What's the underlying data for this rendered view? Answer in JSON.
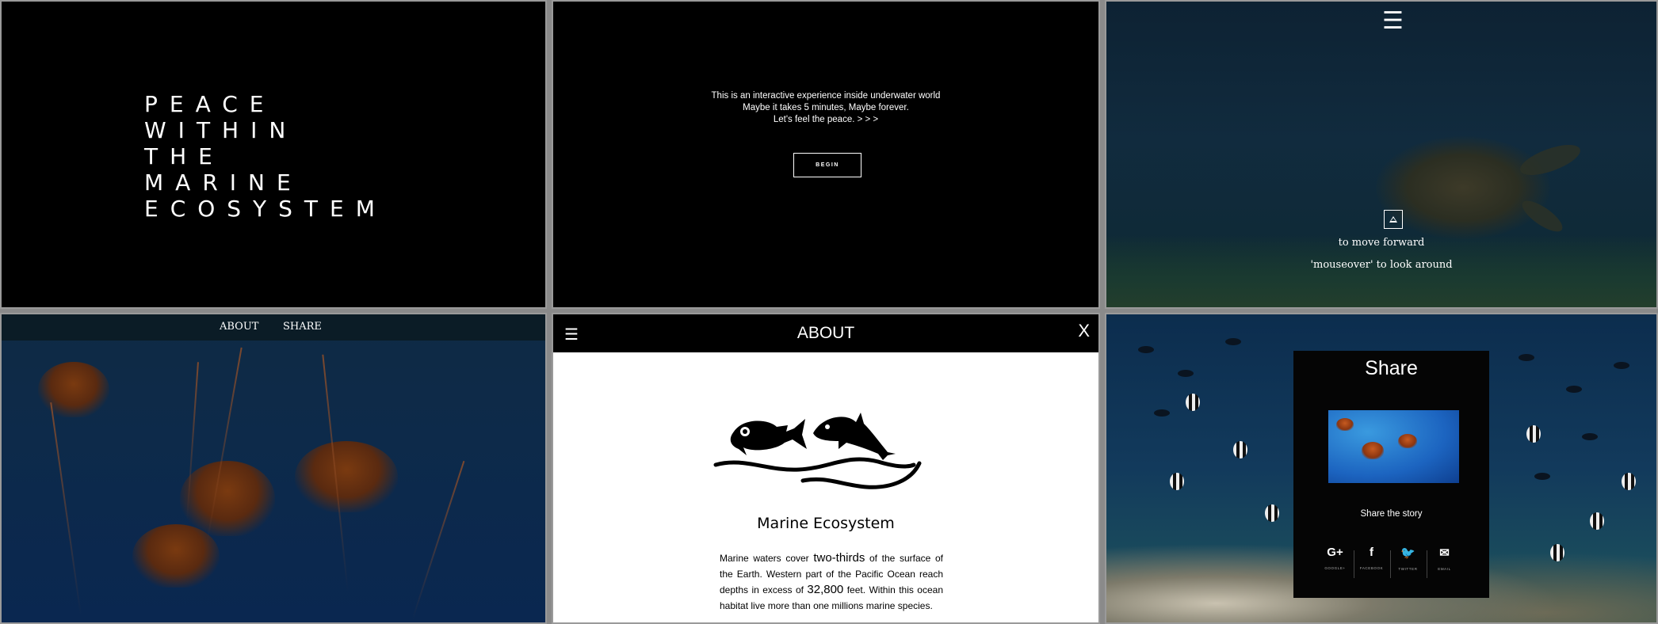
{
  "panel1": {
    "title_lines": [
      "PEACE",
      "WITHIN",
      "THE",
      "MARINE",
      "ECOSYSTEM"
    ]
  },
  "panel2": {
    "intro_lines": [
      "This is an interactive experience inside underwater world",
      "Maybe it takes 5 minutes, Maybe forever.",
      "Let's feel the peace. > > >"
    ],
    "begin_label": "BEGIN"
  },
  "panel3": {
    "menu_icon": "hamburger-icon",
    "forward_hint": "to move forward",
    "look_hint": "'mouseover' to look around"
  },
  "panel4": {
    "nav": {
      "about": "ABOUT",
      "share": "SHARE"
    }
  },
  "panel5": {
    "menu_icon": "hamburger-icon",
    "title": "ABOUT",
    "close_label": "X",
    "logo": "fish-logo-icon",
    "subtitle": "Marine Ecosystem",
    "text": {
      "p1": "Marine waters cover ",
      "big1": "two-thirds",
      "p2": " of the surface of the Earth.    Western part of the Pacific Ocean reach depths in  excess of ",
      "big2": "32,800",
      "p3": " feet. Within this ocean habitat  live  more than one millions marine species."
    }
  },
  "panel6": {
    "title": "Share",
    "image": "jellyfish-thumbnail",
    "story_label": "Share the story",
    "social": [
      {
        "icon": "G+",
        "label": "GOOGLE+"
      },
      {
        "icon": "f",
        "label": "FACEBOOK"
      },
      {
        "icon": "🐦",
        "label": "TWITTER"
      },
      {
        "icon": "✉",
        "label": "EMAIL"
      }
    ]
  }
}
